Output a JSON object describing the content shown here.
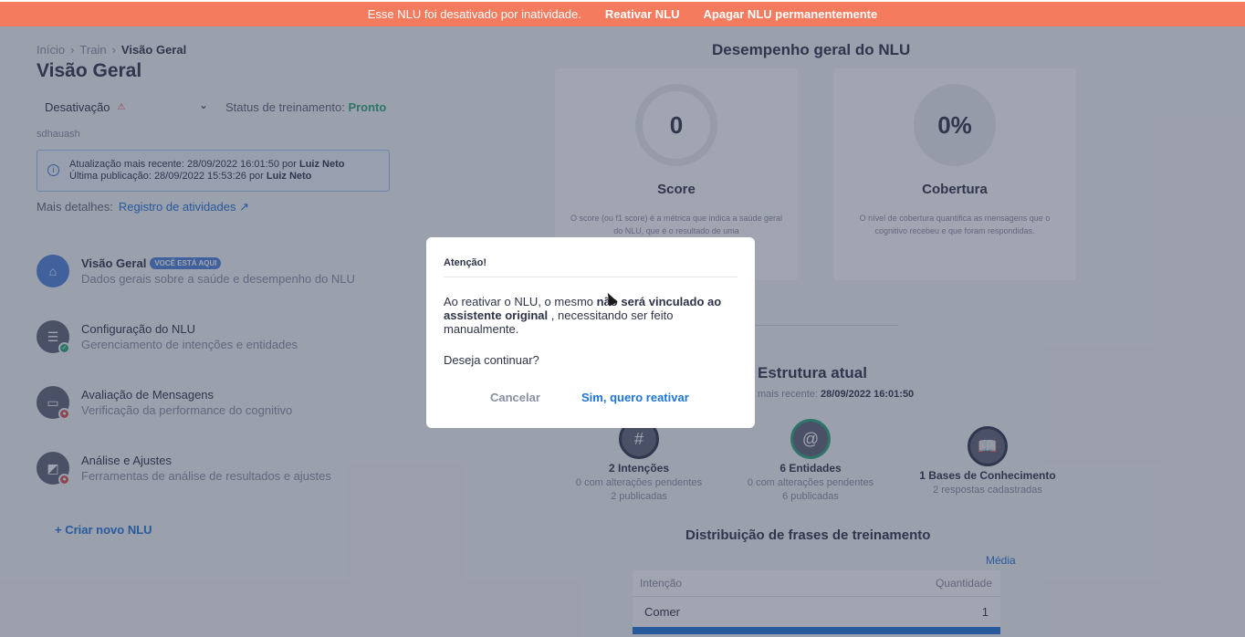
{
  "banner": {
    "message": "Esse NLU foi desativado por inatividade.",
    "reactivate": "Reativar NLU",
    "delete": "Apagar NLU permanentemente"
  },
  "breadcrumb": [
    "Início",
    "Train",
    "Visão Geral"
  ],
  "page_title": "Visão Geral",
  "select": {
    "value": "Desativação"
  },
  "training_status": {
    "label": "Status de treinamento:",
    "value": "Pronto"
  },
  "subtitle": "sdhauash",
  "info": {
    "update_label": "Atualização mais recente:",
    "update_date": "28/09/2022 16:01:50",
    "update_by": "por",
    "update_user": "Luiz Neto",
    "publish_label": "Última publicação:",
    "publish_date": "28/09/2022 15:53:26",
    "publish_by": "por",
    "publish_user": "Luiz Neto"
  },
  "details": {
    "label": "Mais detalhes:",
    "link": "Registro de atividades"
  },
  "steps": [
    {
      "title": "Visão Geral",
      "badge": "VOCÊ ESTÁ AQUI",
      "desc": "Dados gerais sobre a saúde e desempenho do NLU",
      "icon": "home-icon"
    },
    {
      "title": "Configuração do NLU",
      "desc": "Gerenciamento de intenções e entidades",
      "icon": "sliders-icon"
    },
    {
      "title": "Avaliação de Mensagens",
      "desc": "Verificação da performance do cognitivo",
      "icon": "inbox-icon"
    },
    {
      "title": "Análise e Ajustes",
      "desc": "Ferramentas de análise de resultados e ajustes",
      "icon": "chart-icon"
    }
  ],
  "new_nlu": "Criar novo NLU",
  "performance": {
    "title": "Desempenho geral do NLU",
    "score": {
      "value": "0",
      "label": "Score",
      "text": "O score (ou f1 score) é a métrica que indica a saúde geral do NLU, que é o resultado de uma"
    },
    "coverage": {
      "value": "0%",
      "label": "Cobertura",
      "text": "O nível de cobertura quantifica as mensagens que o cognitivo recebeu e que foram respondidas."
    }
  },
  "structure": {
    "title": "Estrutura atual",
    "update_label": "mais recente:",
    "update_date": "28/09/2022 16:01:50",
    "intents": {
      "name": "2 Intenções",
      "pending": "0 com alterações pendentes",
      "published": "2 publicadas"
    },
    "entities": {
      "name": "6 Entidades",
      "pending": "0 com alterações pendentes",
      "published": "6 publicadas"
    },
    "kb": {
      "name": "1 Bases de Conhecimento",
      "answers": "2 respostas cadastradas"
    }
  },
  "distribution": {
    "title": "Distribuição de frases de treinamento",
    "media_link": "Média",
    "columns": [
      "Intenção",
      "Quantidade"
    ],
    "rows": [
      {
        "intent": "Comer",
        "qty": "1"
      }
    ]
  },
  "modal": {
    "title": "Atenção!",
    "body_1": "Ao reativar o NLU, o mesmo",
    "body_bold": "não será vinculado ao assistente original",
    "body_2": ", necessitando ser feito manualmente.",
    "question": "Deseja continuar?",
    "cancel": "Cancelar",
    "confirm": "Sim, quero reativar"
  }
}
